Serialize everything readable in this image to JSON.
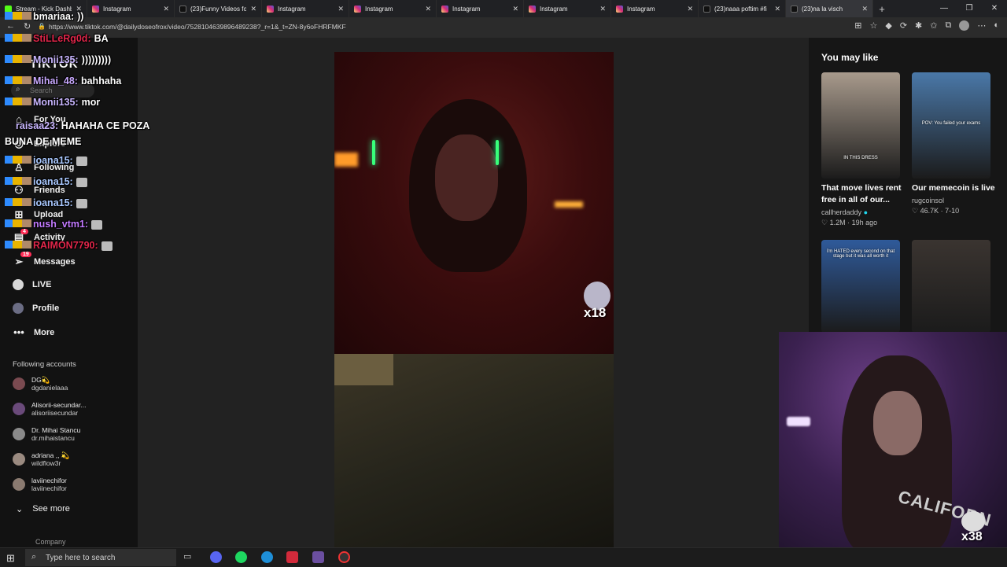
{
  "browser": {
    "tabs": [
      {
        "icon": "kick",
        "title": "Stream - Kick Dashb"
      },
      {
        "icon": "instagram",
        "title": "Instagram"
      },
      {
        "icon": "tiktok",
        "title": "(23)Funny Videos fo"
      },
      {
        "icon": "instagram",
        "title": "Instagram"
      },
      {
        "icon": "instagram",
        "title": "Instagram"
      },
      {
        "icon": "instagram",
        "title": "Instagram"
      },
      {
        "icon": "instagram",
        "title": "Instagram"
      },
      {
        "icon": "instagram",
        "title": "Instagram"
      },
      {
        "icon": "tiktok",
        "title": "(23)naaa poftim #fi"
      },
      {
        "icon": "tiktok",
        "title": "(23)na la visch"
      }
    ],
    "new_tab": "+",
    "url": "https://www.tiktok.com/@dailydoseofrox/video/7528104639896489238?_r=1&_t=ZN-8y6oFHRFMKF"
  },
  "sidebar": {
    "logo": "TikTok",
    "search_placeholder": "Search",
    "nav": [
      {
        "icon": "home-icon",
        "glyph": "⌂",
        "label": "For You"
      },
      {
        "icon": "compass-icon",
        "glyph": "◎",
        "label": "Explore"
      },
      {
        "icon": "following-icon",
        "glyph": "♙",
        "label": "Following"
      },
      {
        "icon": "friends-icon",
        "glyph": "⚇",
        "label": "Friends"
      },
      {
        "icon": "upload-icon",
        "glyph": "⊞",
        "label": "Upload"
      },
      {
        "icon": "activity-icon",
        "glyph": "▤",
        "label": "Activity"
      },
      {
        "icon": "messages-icon",
        "glyph": "➢",
        "label": "Messages"
      },
      {
        "icon": "live-icon",
        "glyph": "",
        "label": "LIVE"
      },
      {
        "icon": "profile-icon",
        "glyph": "",
        "label": "Profile"
      },
      {
        "icon": "more-icon",
        "glyph": "•••",
        "label": "More"
      }
    ],
    "messages_badge": "19",
    "activity_badge": "4",
    "following_title": "Following accounts",
    "accounts": [
      {
        "name": "DG💫",
        "handle": "dgdanielaaa",
        "color": "#7a4a50"
      },
      {
        "name": "Alisorii-secundar...",
        "handle": "alisoriisecundar",
        "color": "#6a4a7a"
      },
      {
        "name": "Dr. Mihai Stancu",
        "handle": "dr.mihaistancu",
        "color": "#8a8a8a"
      },
      {
        "name": "adriana ,, 💫",
        "handle": "wildflow3r",
        "color": "#9a8a80"
      },
      {
        "name": "laviinechifor",
        "handle": "laviinechifor",
        "color": "#8a7a70"
      }
    ],
    "see_more": "See more",
    "company": "Company"
  },
  "chat": {
    "lines": [
      {
        "user": "bmariaa:",
        "msg": "))",
        "color": "#ffffff"
      },
      {
        "user": "StiLLeRg0d:",
        "msg": "BA",
        "color": "#e0264a"
      },
      {
        "user": "Monii135:",
        "msg": ")))))))))",
        "color": "#c9b6ff"
      },
      {
        "user": "Mihai_48:",
        "msg": "bahhaha",
        "color": "#c9a9ff"
      },
      {
        "user": "Monii135:",
        "msg": "mor",
        "color": "#c9b6ff"
      },
      {
        "user": "raisaa23:",
        "msg": "HAHAHA CE POZA BUNA DE MEME",
        "color": "#c9b6ff"
      },
      {
        "user": "ioana15:",
        "msg": "",
        "color": "#a9c8ff"
      },
      {
        "user": "ioana15:",
        "msg": "",
        "color": "#a9c8ff"
      },
      {
        "user": "ioana15:",
        "msg": "",
        "color": "#a9c8ff"
      },
      {
        "user": "nush_vtm1:",
        "msg": "",
        "color": "#c27aff"
      },
      {
        "user": "RAIMON7790:",
        "msg": "",
        "color": "#e0264a"
      }
    ]
  },
  "video": {
    "sticker_multiplier": "x18"
  },
  "you_may_like": {
    "title": "You may like",
    "items": [
      {
        "caption_line1": "That move lives rent",
        "caption_line2": "free in all of our...",
        "author": "callherdaddy",
        "likes": "1.2M",
        "age": "19h ago",
        "thumb_text": "IN THIS DRESS",
        "thumb_color": "#a89a8c"
      },
      {
        "caption_line1": "Our memecoin is live",
        "caption_line2": "",
        "author": "rugcoinsol",
        "likes": "46.7K",
        "age": "7-10",
        "thumb_text": "POV: You failed your exams",
        "thumb_color": "#4a78a8"
      },
      {
        "caption_line1": "",
        "caption_line2": "",
        "author": "",
        "likes": "",
        "age": "",
        "thumb_text": "i'm HATED every second on that stage but it was all worth it",
        "thumb_color": "#2f5a9a"
      },
      {
        "caption_line1": "",
        "caption_line2": "",
        "author": "",
        "likes": "",
        "age": "",
        "thumb_text": "",
        "thumb_color": "#3a3430"
      }
    ]
  },
  "webcam": {
    "shirt_text": "CALIFORN",
    "multiplier": "x38"
  },
  "taskbar": {
    "search_placeholder": "Type here to search"
  }
}
